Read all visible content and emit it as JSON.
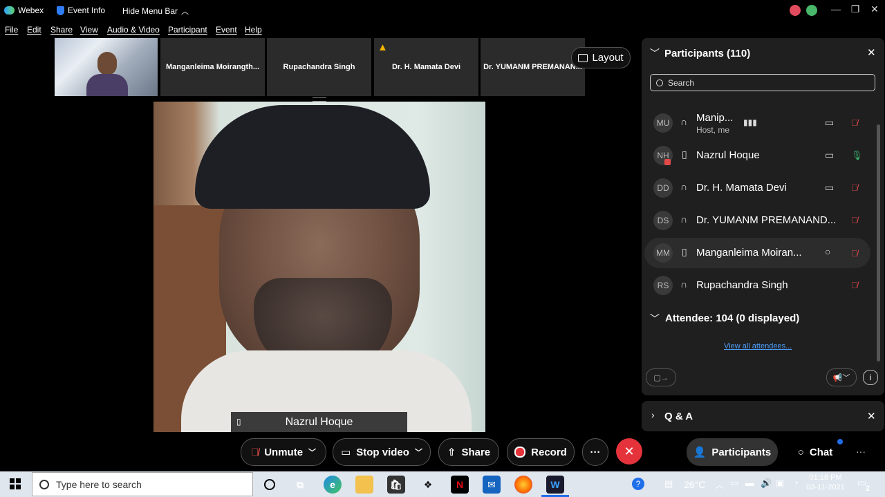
{
  "titlebar": {
    "app_name": "Webex",
    "event_info": "Event Info",
    "hide_menu": "Hide Menu Bar"
  },
  "menu": [
    "File",
    "Edit",
    "Share",
    "View",
    "Audio & Video",
    "Participant",
    "Event",
    "Help"
  ],
  "thumbnails": [
    "Manganleima Moirangth...",
    "Rupachandra Singh",
    "Dr. H. Mamata Devi",
    "Dr. YUMANM PREMANAN..."
  ],
  "layout_label": "Layout",
  "main_video": {
    "name": "Nazrul Hoque"
  },
  "participants_panel": {
    "title": "Participants (110)",
    "search_placeholder": "Search",
    "rows": [
      {
        "initials": "MU",
        "name": "Manip...",
        "sub": "Host, me"
      },
      {
        "initials": "NH",
        "name": "Nazrul Hoque"
      },
      {
        "initials": "DD",
        "name": "Dr. H. Mamata Devi"
      },
      {
        "initials": "DS",
        "name": "Dr. YUMANM PREMANAND..."
      },
      {
        "initials": "MM",
        "name": "Manganleima Moiran..."
      },
      {
        "initials": "RS",
        "name": "Rupachandra Singh"
      }
    ],
    "attendee_header": "Attendee: 104 (0 displayed)",
    "view_all": "View all attendees..."
  },
  "qa_panel": {
    "title": "Q & A"
  },
  "controls": {
    "unmute": "Unmute",
    "stop_video": "Stop video",
    "share": "Share",
    "record": "Record",
    "participants": "Participants",
    "chat": "Chat"
  },
  "taskbar": {
    "search_placeholder": "Type here to search",
    "temperature": "26°C",
    "time": "01:18 PM",
    "date": "03-11-2021",
    "notifications": "2"
  },
  "colors": {
    "end_call": "#e5333b",
    "accent_blue": "#1f6feb",
    "mic_green": "#3cb371",
    "mic_muted": "#e24a4a"
  }
}
